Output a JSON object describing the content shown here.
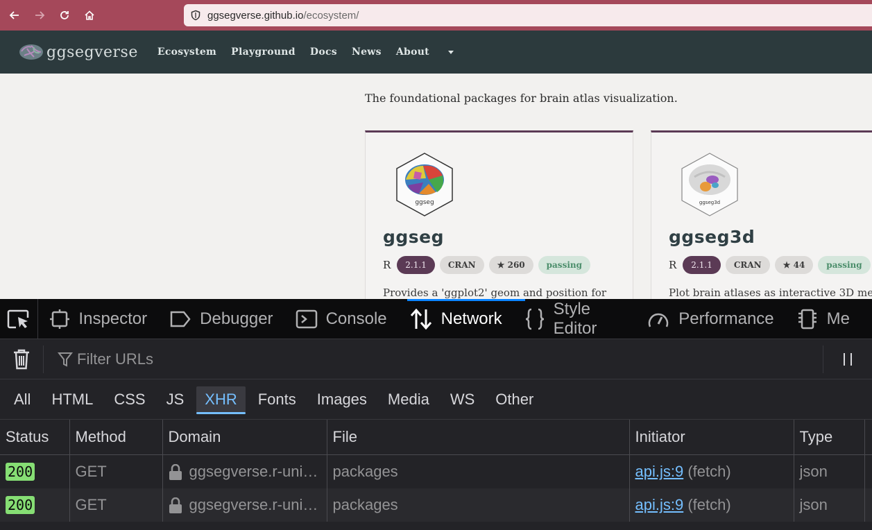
{
  "browser": {
    "url_domain": "ggsegverse.github.io",
    "url_path": "/ecosystem/"
  },
  "site": {
    "brand": "ggsegverse",
    "nav": [
      "Ecosystem",
      "Playground",
      "Docs",
      "News",
      "About"
    ]
  },
  "content": {
    "lead": "The foundational packages for brain atlas visualization.",
    "cards": [
      {
        "hex_label": "ggseg",
        "title": "ggseg",
        "lang": "R",
        "version": "2.1.1",
        "repo": "CRAN",
        "stars": "★ 260",
        "status": "passing",
        "description": "Provides a 'ggplot2' geom and position for"
      },
      {
        "hex_label": "ggseg3d",
        "title": "ggseg3d",
        "lang": "R",
        "version": "2.1.1",
        "repo": "CRAN",
        "stars": "★ 44",
        "status": "passing",
        "description": "Plot brain atlases as interactive 3D me"
      }
    ]
  },
  "devtools": {
    "tabs": [
      "Inspector",
      "Debugger",
      "Console",
      "Network",
      "Style Editor",
      "Performance",
      "Me"
    ],
    "active_tab": "Network",
    "filter_placeholder": "Filter URLs",
    "types": [
      "All",
      "HTML",
      "CSS",
      "JS",
      "XHR",
      "Fonts",
      "Images",
      "Media",
      "WS",
      "Other"
    ],
    "active_type": "XHR",
    "columns": [
      "Status",
      "Method",
      "Domain",
      "File",
      "Initiator",
      "Type"
    ],
    "rows": [
      {
        "status": "200",
        "method": "GET",
        "domain": "ggsegverse.r-uni…",
        "file": "packages",
        "initiator": "api.js:9",
        "initiator_extra": "(fetch)",
        "type": "json"
      },
      {
        "status": "200",
        "method": "GET",
        "domain": "ggsegverse.r-uni…",
        "file": "packages",
        "initiator": "api.js:9",
        "initiator_extra": "(fetch)",
        "type": "json"
      }
    ]
  }
}
